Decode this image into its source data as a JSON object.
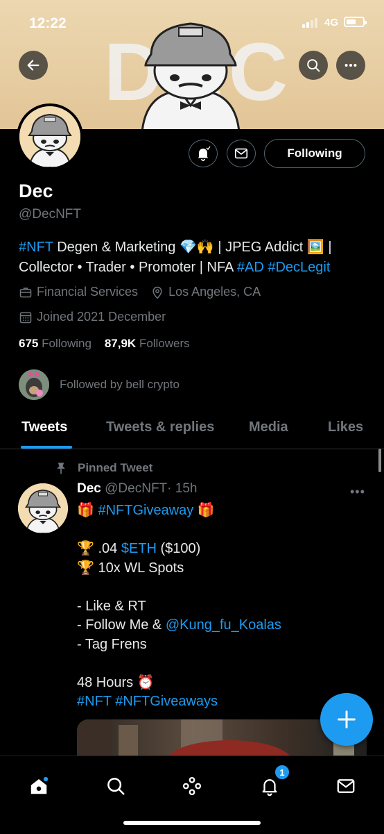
{
  "status_bar": {
    "time": "12:22",
    "network": "4G"
  },
  "banner": {
    "text": "DEC"
  },
  "profile": {
    "name": "Dec",
    "handle": "@DecNFT",
    "follow_button": "Following",
    "bio": {
      "tag_nft": "#NFT",
      "part1": " Degen & Marketing ",
      "emoji1": "💎🙌",
      "part2": " | JPEG Addict ",
      "emoji2": "🖼️",
      "part3": " | Collector • Trader • Promoter | NFA ",
      "tag_ad": "#AD",
      "tag_declegit": "#DecLegit"
    },
    "category": "Financial Services",
    "location": "Los Angeles, CA",
    "joined": "Joined 2021 December",
    "following_count": "675",
    "following_label": "Following",
    "followers_count": "87,9K",
    "followers_label": "Followers",
    "followed_by": "Followed by bell crypto"
  },
  "tabs": [
    "Tweets",
    "Tweets & replies",
    "Media",
    "Likes"
  ],
  "tweet": {
    "pinned_label": "Pinned Tweet",
    "author": "Dec",
    "handle": "@DecNFT",
    "time": "· 15h",
    "line1_emoji": "🎁",
    "line1_tag": "#NFTGiveaway",
    "line2_emoji": "🏆",
    "line2_text": " .04 ",
    "line2_tag": "$ETH",
    "line2_rest": " ($100)",
    "line3_emoji": "🏆",
    "line3_text": " 10x WL Spots",
    "line4": "- Like & RT",
    "line5_text": "- Follow Me & ",
    "line5_mention": "@Kung_fu_Koalas",
    "line6": "- Tag Frens",
    "line7_text": "48 Hours ",
    "line7_emoji": "⏰",
    "line8_tag1": "#NFT",
    "line8_tag2": "#NFTGiveaways"
  },
  "notifications_badge": "1",
  "colors": {
    "accent": "#1d9bf0",
    "background": "#000000",
    "muted": "#71767b"
  }
}
